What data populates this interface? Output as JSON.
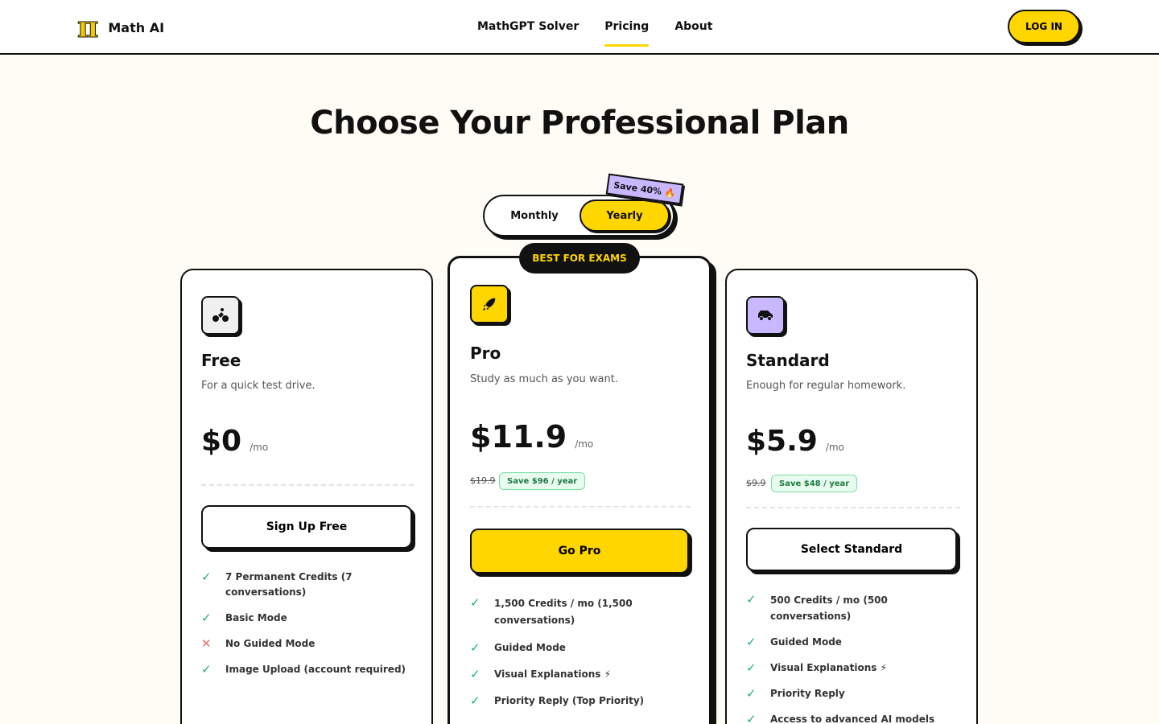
{
  "header": {
    "logo_symbol": "π",
    "brand": "Math AI",
    "nav": [
      {
        "label": "MathGPT Solver",
        "active": false
      },
      {
        "label": "Pricing",
        "active": true
      },
      {
        "label": "About",
        "active": false
      }
    ],
    "login_label": "LOG IN"
  },
  "main": {
    "title": "Choose Your Professional Plan",
    "billing_toggle": {
      "monthly_label": "Monthly",
      "yearly_label": "Yearly",
      "selected": "Yearly",
      "save_badge": "Save 40% 🔥"
    },
    "best_badge": "BEST FOR EXAMS",
    "plans": [
      {
        "name": "Free",
        "description": "For a quick test drive.",
        "price": "$0",
        "per": "/mo",
        "cta": "Sign Up Free",
        "icon": "bike-icon",
        "icon_bg": "#f0f0f0",
        "features": [
          {
            "text": "7 Permanent Credits (7 conversations)",
            "included": true
          },
          {
            "text": "Basic Mode",
            "included": true
          },
          {
            "text": "No Guided Mode",
            "included": false
          },
          {
            "text": "Image Upload (account required)",
            "included": true
          }
        ]
      },
      {
        "name": "Pro",
        "description": "Study as much as you want.",
        "price": "$11.9",
        "per": "/mo",
        "old_price": "$19.9",
        "savings": "Save $96 / year",
        "cta": "Go Pro",
        "icon": "rocket-icon",
        "icon_bg": "#ffd600",
        "features": [
          {
            "text": "1,500 Credits / mo (1,500 conversations)",
            "included": true
          },
          {
            "text": "Guided Mode",
            "included": true
          },
          {
            "text": "Visual Explanations ⚡",
            "included": true
          },
          {
            "text": "Priority Reply (Top Priority)",
            "included": true
          }
        ]
      },
      {
        "name": "Standard",
        "description": "Enough for regular homework.",
        "price": "$5.9",
        "per": "/mo",
        "old_price": "$9.9",
        "savings": "Save $48 / year",
        "cta": "Select Standard",
        "icon": "car-icon",
        "icon_bg": "#c9b8ff",
        "features": [
          {
            "text": "500 Credits / mo (500 conversations)",
            "included": true
          },
          {
            "text": "Guided Mode",
            "included": true
          },
          {
            "text": "Visual Explanations ⚡",
            "included": true
          },
          {
            "text": "Priority Reply",
            "included": true
          },
          {
            "text": "Access to advanced AI models",
            "included": true
          }
        ]
      }
    ]
  },
  "colors": {
    "accent": "#ffd600",
    "background": "#fefcf4",
    "lavender": "#c9b8ff",
    "check": "#1fb36a",
    "cross": "#ef6b6b"
  }
}
